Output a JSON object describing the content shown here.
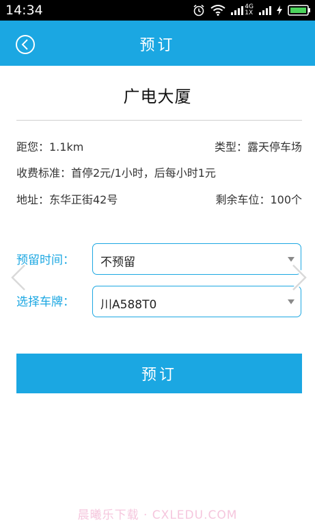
{
  "status_bar": {
    "time": "14:34",
    "network_top": "4G",
    "network_bottom": "1X",
    "icons": [
      "alarm-icon",
      "wifi-icon",
      "signal-icon",
      "signal-icon",
      "battery-charging-icon"
    ]
  },
  "header": {
    "title": "预订",
    "back_icon": "back-arrow-icon",
    "background": "#1ba7e2"
  },
  "place": {
    "name": "广电大厦",
    "distance": "距您：1.1km",
    "type": "类型：露天停车场",
    "fee": "收费标准：首停2元/1小时，后每小时1元",
    "address": "地址：东华正街42号",
    "spaces_left": "剩余车位：100个"
  },
  "form": {
    "reserve_time_label": "预留时间：",
    "reserve_time_value": "不预留",
    "plate_label": "选择车牌：",
    "plate_value": "川A588T0"
  },
  "actions": {
    "book_label": "预订"
  },
  "watermark": "晨曦乐下载 · CXLEDU.COM",
  "colors": {
    "accent": "#1ba7e2",
    "watermark": "#f5c6dd"
  }
}
